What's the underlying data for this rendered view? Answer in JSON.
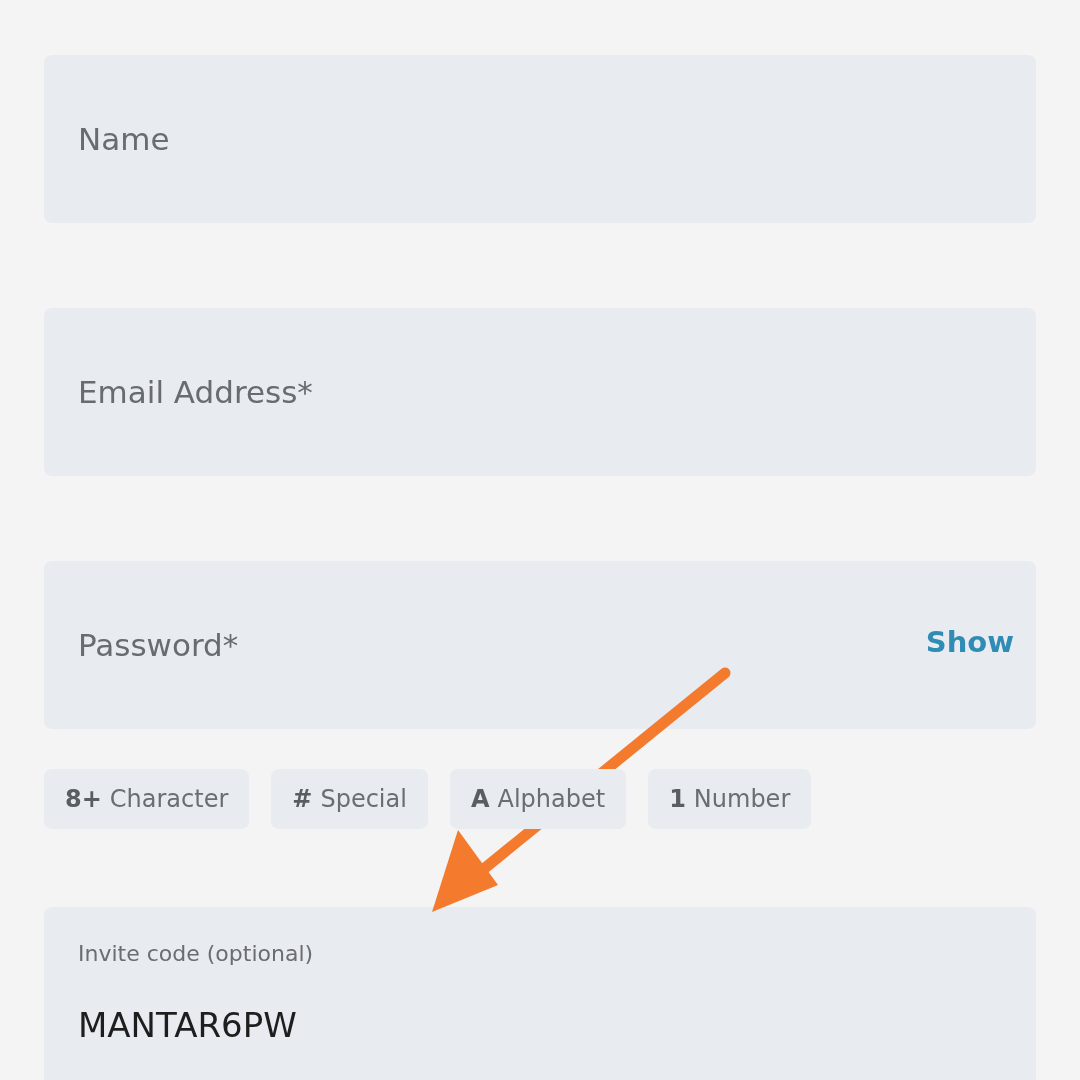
{
  "fields": [
    {
      "placeholder": "Name"
    },
    {
      "placeholder": "Email Address*"
    },
    {
      "placeholder": "Password*",
      "action": "Show"
    }
  ],
  "requirements": [
    {
      "symbol": "8+",
      "label": "Character"
    },
    {
      "symbol": "#",
      "label": "Special"
    },
    {
      "symbol": "A",
      "label": "Alphabet"
    },
    {
      "symbol": "1",
      "label": "Number"
    }
  ],
  "invite": {
    "label": "Invite code (optional)",
    "value": "MANTAR6PW"
  }
}
